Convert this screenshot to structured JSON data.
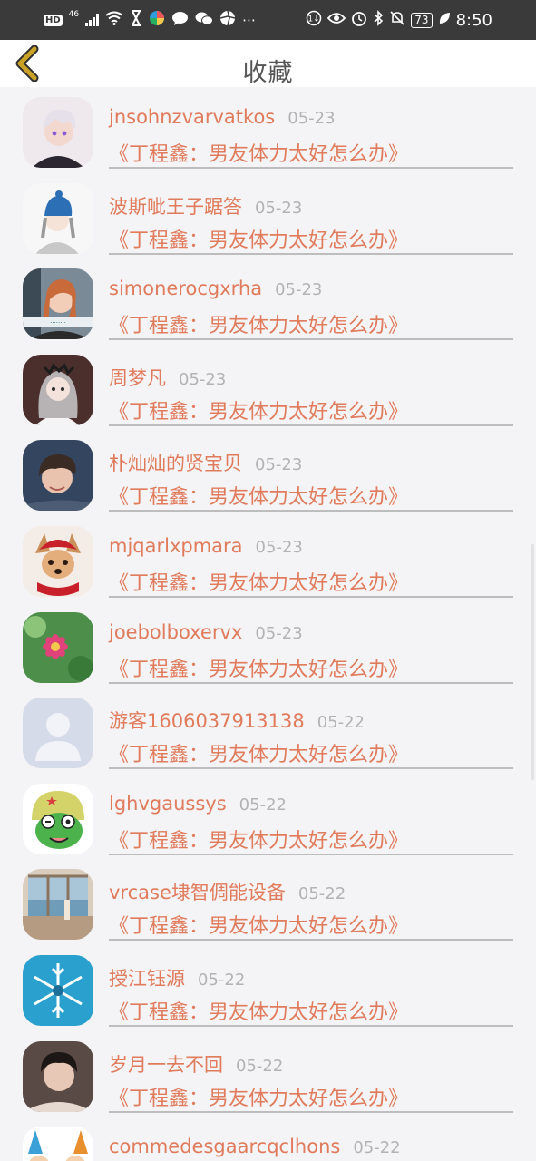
{
  "status_bar": {
    "hd": "HD",
    "network": "46",
    "battery": "73",
    "time": "8:50"
  },
  "header": {
    "title": "收藏",
    "back_icon": "chevron-left-icon"
  },
  "colors": {
    "accent": "#e07b5c",
    "back_arrow": "#c9a227",
    "date": "#b3b3b3",
    "background": "#f4f3f5"
  },
  "favorites": [
    {
      "name": "jnsohnzvarvatkos",
      "date": "05-23",
      "title": "《丁程鑫：男友体力太好怎么办》",
      "avatar": "anime-boy-avatar"
    },
    {
      "name": "波斯呲王子踞答",
      "date": "05-23",
      "title": "《丁程鑫：男友体力太好怎么办》",
      "avatar": "anime-beanie-avatar"
    },
    {
      "name": "simonerocgxrha",
      "date": "05-23",
      "title": "《丁程鑫：男友体力太好怎么办》",
      "avatar": "photo-girl-avatar"
    },
    {
      "name": "周梦凡",
      "date": "05-23",
      "title": "《丁程鑫：男友体力太好怎么办》",
      "avatar": "anime-girl-avatar"
    },
    {
      "name": "朴灿灿的贤宝贝",
      "date": "05-23",
      "title": "《丁程鑫：男友体力太好怎么办》",
      "avatar": "photo-boy-avatar"
    },
    {
      "name": "mjqarlxpmara",
      "date": "05-23",
      "title": "《丁程鑫：男友体力太好怎么办》",
      "avatar": "dog-hat-avatar"
    },
    {
      "name": "joebolboxervx",
      "date": "05-23",
      "title": "《丁程鑫：男友体力太好怎么办》",
      "avatar": "flower-avatar"
    },
    {
      "name": "游客1606037913138",
      "date": "05-22",
      "title": "《丁程鑫：男友体力太好怎么办》",
      "avatar": "default-user-avatar"
    },
    {
      "name": "lghvgaussys",
      "date": "05-22",
      "title": "《丁程鑫：男友体力太好怎么办》",
      "avatar": "frog-cartoon-avatar"
    },
    {
      "name": "vrcase埭智倜能设备",
      "date": "05-22",
      "title": "《丁程鑫：男友体力太好怎么办》",
      "avatar": "window-room-avatar"
    },
    {
      "name": "授江钰源",
      "date": "05-22",
      "title": "《丁程鑫：男友体力太好怎么办》",
      "avatar": "snowflake-avatar"
    },
    {
      "name": "岁月一去不回",
      "date": "05-22",
      "title": "《丁程鑫：男友体力太好怎么办》",
      "avatar": "photo-man-avatar"
    },
    {
      "name": "commedesgaarcqclhons",
      "date": "05-22",
      "title": "",
      "avatar": "cartoon-party-avatar"
    }
  ]
}
